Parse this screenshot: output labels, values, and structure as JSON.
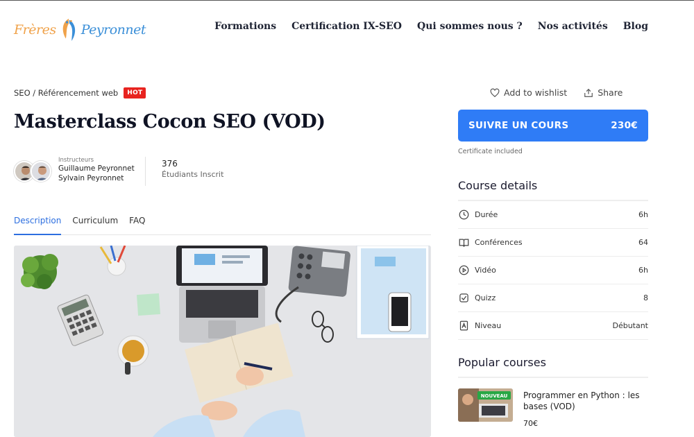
{
  "brand": {
    "left": "Frères",
    "right": "Peyronnet"
  },
  "nav": [
    "Formations",
    "Certification IX-SEO",
    "Qui sommes nous ?",
    "Nos activités",
    "Blog"
  ],
  "breadcrumb": {
    "text": "SEO / Référencement web",
    "badge": "HOT"
  },
  "course": {
    "title": "Masterclass Cocon SEO (VOD)",
    "instructors_caption": "Instructeurs",
    "instructors": [
      "Guillaume Peyronnet",
      "Sylvain Peyronnet"
    ],
    "students_count": "376",
    "students_label": "Étudiants Inscrit"
  },
  "tabs": [
    "Description",
    "Curriculum",
    "FAQ"
  ],
  "active_tab": "Description",
  "actions": {
    "wishlist": "Add to wishlist",
    "share": "Share"
  },
  "buy": {
    "label": "SUIVRE UN COURS",
    "price": "230€",
    "note": "Certificate included"
  },
  "details": {
    "title": "Course details",
    "rows": [
      {
        "icon": "clock-icon",
        "label": "Durée",
        "value": "6h"
      },
      {
        "icon": "book-icon",
        "label": "Conférences",
        "value": "64"
      },
      {
        "icon": "play-icon",
        "label": "Vidéo",
        "value": "6h"
      },
      {
        "icon": "check-icon",
        "label": "Quizz",
        "value": "8"
      },
      {
        "icon": "level-icon",
        "label": "Niveau",
        "value": "Débutant"
      }
    ]
  },
  "popular": {
    "title": "Popular courses",
    "items": [
      {
        "badge": "NOUVEAU",
        "title": "Programmer en Python : les bases (VOD)",
        "price": "70€"
      }
    ]
  },
  "colors": {
    "accent": "#2f7cf6",
    "hot": "#e8231f",
    "logo_orange": "#f0a24a",
    "logo_blue": "#3b8fd8"
  }
}
